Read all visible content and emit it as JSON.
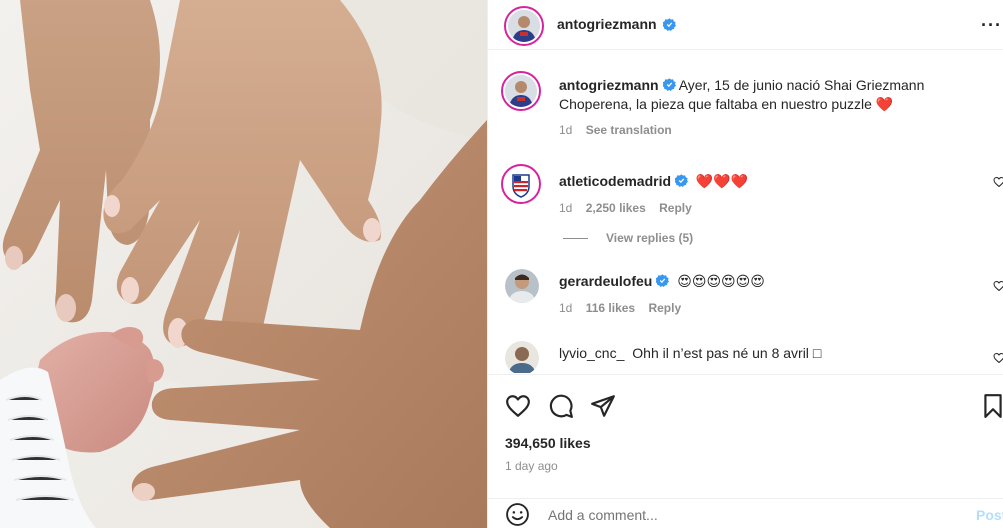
{
  "post": {
    "author": "antogriezmann",
    "caption": "Ayer, 15 de junio nació Shai Griezmann Choperena, la pieza que faltaba en nuestro puzzle",
    "caption_emoji": "❤️",
    "age": "1d",
    "see_translation": "See translation",
    "likes": "394,650 likes",
    "posted_ago": "1 day ago"
  },
  "header": {
    "username": "antogriezmann",
    "more": "···"
  },
  "comments": [
    {
      "user": "atleticodemadrid",
      "verified": true,
      "text": "❤️❤️❤️",
      "age": "1d",
      "likes": "2,250 likes",
      "reply": "Reply",
      "view_replies": "View replies (5)"
    },
    {
      "user": "gerardeulofeu",
      "verified": true,
      "text": "😍😍😍😍😍😍",
      "age": "1d",
      "likes": "116 likes",
      "reply": "Reply"
    },
    {
      "user": "lyvio_cnc_",
      "verified": false,
      "text": "Ohh il n’est pas né un 8 avril",
      "text_trailing_glyph": "□"
    }
  ],
  "add_comment": {
    "placeholder": "Add a comment...",
    "post_label": "Post"
  },
  "icons": {
    "like": "heart-icon",
    "comment": "comment-icon",
    "share": "share-icon",
    "save": "bookmark-icon",
    "emoji": "smile-icon",
    "verified": "verified-badge-icon",
    "comment_like": "heart-outline-icon"
  },
  "colors": {
    "verified": "#3897f0",
    "text": "#262626",
    "secondary": "#8e8e8e",
    "post_disabled": "#b2dffc",
    "heart": "#ed4956"
  }
}
